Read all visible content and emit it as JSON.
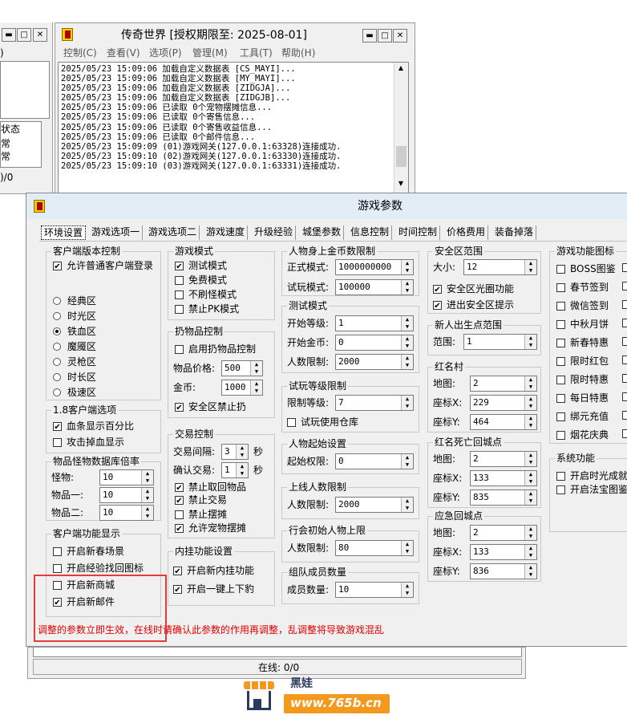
{
  "left_window": {
    "column_header": "状态",
    "rows": [
      "常",
      "常"
    ],
    "footer": ")/0",
    "menu_fragment": ")"
  },
  "main_window": {
    "title": "传奇世界 [授权期限至: 2025-08-01]",
    "menu": [
      "控制(C)",
      "查看(V)",
      "选项(P)",
      "管理(M)",
      "工具(T)",
      "帮助(H)"
    ],
    "log": [
      "2025/05/23 15:09:06 加载自定义数据表 [CS_MAYI]...",
      "2025/05/23 15:09:06 加载自定义数据表 [MY_MAYI]...",
      "2025/05/23 15:09:06 加载自定义数据表 [ZIDGJA]...",
      "2025/05/23 15:09:06 加载自定义数据表 [ZIDGJB]...",
      "2025/05/23 15:09:06 已读取 0个宠物摆摊信息...",
      "2025/05/23 15:09:06 已读取 0个寄售信息...",
      "2025/05/23 15:09:06 已读取 0个寄售收益信息...",
      "2025/05/23 15:09:06 已读取 0个邮件信息...",
      "2025/05/23 15:09:09 (01)游戏网关(127.0.0.1:63328)连接成功...",
      "2025/05/23 15:09:10 (02)游戏网关(127.0.0.1:63330)连接成功...",
      "2025/05/23 15:09:10 (03)游戏网关(127.0.0.1:63331)连接成功..."
    ],
    "status_online": "在线: 0/0"
  },
  "dialog": {
    "title": "游戏参数",
    "tabs": [
      "环境设置",
      "游戏选项一",
      "游戏选项二",
      "游戏速度",
      "升级经验",
      "城堡参数",
      "信息控制",
      "时间控制",
      "价格费用",
      "装备掉落"
    ],
    "client_version": {
      "label": "客户端版本控制",
      "allow_normal": "允许普通客户端登录",
      "zones": [
        "经典区",
        "时光区",
        "铁血区",
        "魔魇区",
        "灵枪区",
        "时长区",
        "极速区"
      ],
      "selected_zone": "铁血区"
    },
    "client_18": {
      "label": "1.8客户端选项",
      "hp_percent": "血条显示百分比",
      "attack_drop": "攻击掉血显示"
    },
    "item_monster": {
      "label": "物品怪物数据库倍率",
      "monster_label": "怪物:",
      "monster_value": "10",
      "item1_label": "物品一:",
      "item1_value": "10",
      "item2_label": "物品二:",
      "item2_value": "10"
    },
    "client_display": {
      "label": "客户端功能显示",
      "spring": "开启新春场景",
      "scroll": "开启经验找回图标",
      "shop": "开启新商城",
      "mail": "开启新邮件"
    },
    "game_mode": {
      "label": "游戏模式",
      "test": "测试模式",
      "free": "免费模式",
      "norefresh": "不刷怪模式",
      "nopk": "禁止PK模式"
    },
    "drop_control": {
      "label": "扔物品控制",
      "enable": "启用扔物品控制",
      "price_label": "物品价格:",
      "price_value": "500",
      "gold_label": "金币:",
      "gold_value": "1000",
      "safe_no_drop": "安全区禁止扔"
    },
    "trade": {
      "label": "交易控制",
      "interval_label": "交易间隔:",
      "interval_value": "3",
      "sec": "秒",
      "confirm_label": "确认交易:",
      "confirm_value": "1",
      "sec2": "秒",
      "no_take_back": "禁止取回物品",
      "no_trade": "禁止交易",
      "no_stall": "禁止摆摊",
      "allow_pet_stall": "允许宠物摆摊"
    },
    "plugin": {
      "label": "内挂功能设置",
      "new_plugin": "开启新内挂功能",
      "one_key": "开启一键上下豹"
    },
    "gold_limit": {
      "label": "人物身上金币数限制",
      "formal_label": "正式模式:",
      "formal_value": "1000000000",
      "trial_label": "试玩模式:",
      "trial_value": "100000"
    },
    "test_mode": {
      "label": "测试模式",
      "start_level_label": "开始等级:",
      "start_level_value": "1",
      "start_gold_label": "开始金币:",
      "start_gold_value": "0",
      "people_limit_label": "人数限制:",
      "people_limit_value": "2000"
    },
    "trial_level": {
      "label": "试玩等级限制",
      "limit_label": "限制等级:",
      "limit_value": "7",
      "use_storage": "试玩使用仓库"
    },
    "start_setting": {
      "label": "人物起始设置",
      "perm_label": "起始权限:",
      "perm_value": "0"
    },
    "online_limit": {
      "label": "上线人数限制",
      "people_label": "人数限制:",
      "people_value": "2000"
    },
    "guild_init": {
      "label": "行会初始人物上限",
      "people_label": "人数限制:",
      "people_value": "80"
    },
    "team": {
      "label": "组队成员数量",
      "members_label": "成员数量:",
      "members_value": "10"
    },
    "safe_zone": {
      "label": "安全区范围",
      "size_label": "大小:",
      "size_value": "12",
      "halo": "安全区光圈功能",
      "tip": "进出安全区提示"
    },
    "newbie": {
      "label": "新人出生点范围",
      "range_label": "范围:",
      "range_value": "1"
    },
    "red_village": {
      "label": "红名村",
      "map_label": "地图:",
      "map_value": "2",
      "x_label": "座标X:",
      "x_value": "229",
      "y_label": "座标Y:",
      "y_value": "464"
    },
    "red_death": {
      "label": "红名死亡回城点",
      "map_label": "地图:",
      "map_value": "2",
      "x_label": "座标X:",
      "x_value": "133",
      "y_label": "座标Y:",
      "y_value": "835"
    },
    "emergency": {
      "label": "应急回城点",
      "map_label": "地图:",
      "map_value": "2",
      "x_label": "座标X:",
      "x_value": "133",
      "y_label": "座标Y:",
      "y_value": "836"
    },
    "func_icons": {
      "label": "游戏功能图标",
      "items": [
        "BOSS图鉴",
        "春节签到",
        "微信签到",
        "中秋月饼",
        "新春特惠",
        "限时红包",
        "限时特惠",
        "每日特惠",
        "绑元充值",
        "烟花庆典"
      ]
    },
    "sys_func": {
      "label": "系统功能",
      "items": [
        "开启时光成就",
        "开启法宝图鉴"
      ]
    },
    "warning": "调整的参数立即生效，在线时请确认此参数的作用再调整，乱调整将导致游戏混乱"
  },
  "watermark": {
    "brand": "黑娃",
    "url": "www.765b.cn"
  },
  "colors": {
    "highlight_border": "#e5393b",
    "warning_text": "#e00000",
    "watermark_orange": "#f39a1e"
  }
}
